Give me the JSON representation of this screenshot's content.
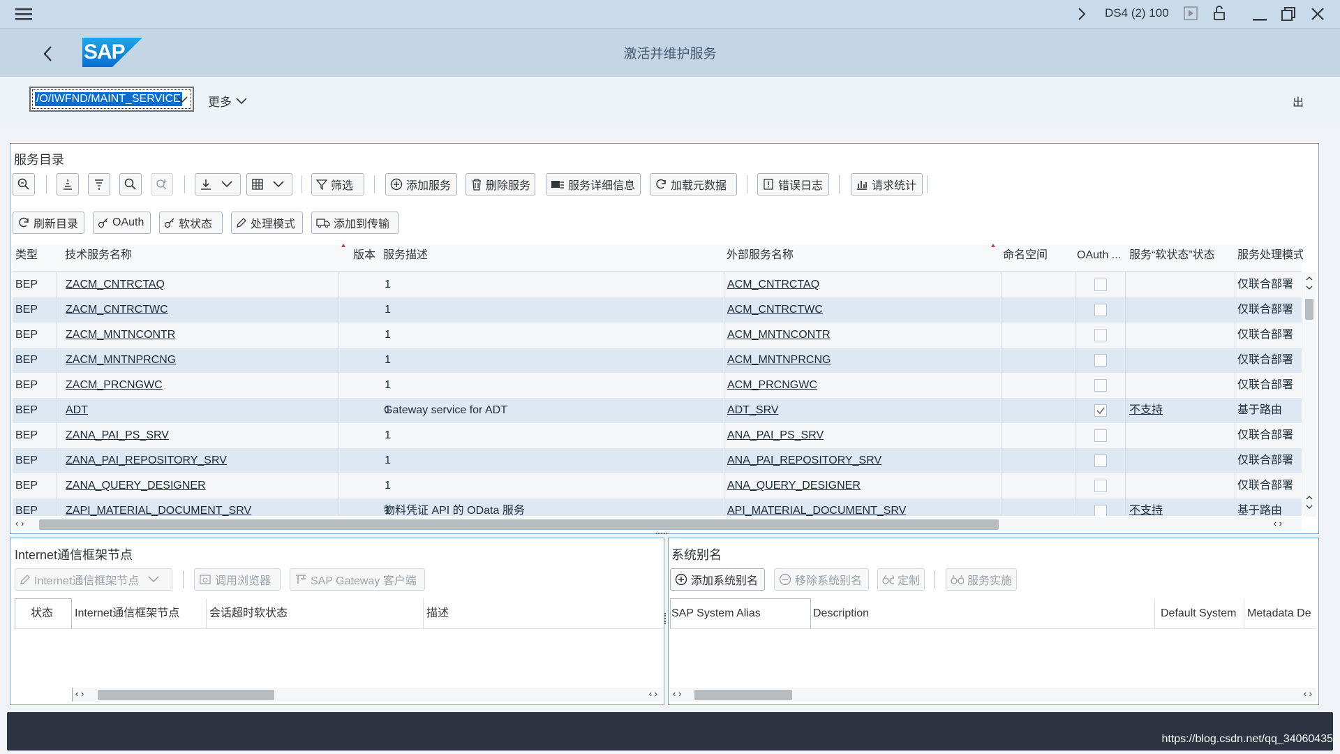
{
  "titlebar": {
    "system": "DS4 (2) 100"
  },
  "header": {
    "title": "激活并维护服务",
    "logo": "SAP"
  },
  "toolbar": {
    "tcode": "/O/IWFND/MAINT_SERVICE",
    "more": "更多",
    "exit": "出"
  },
  "catalog": {
    "title": "服务目录",
    "buttons": {
      "filter": "筛选",
      "add_service": "添加服务",
      "delete_service": "删除服务",
      "service_details": "服务详细信息",
      "load_metadata": "加载元数据",
      "error_log": "错误日志",
      "request_stats": "请求统计",
      "refresh_catalog": "刷新目录",
      "oauth": "OAuth",
      "soft_state": "软状态",
      "processing_mode": "处理模式",
      "add_to_transport": "添加到传输"
    },
    "columns": [
      "类型",
      "技术服务名称",
      "版本",
      "服务描述",
      "外部服务名称",
      "命名空间",
      "OAuth ...",
      "服务“软状态”状态",
      "服务处理模式"
    ],
    "rows": [
      {
        "type": "BEP",
        "tech": "ZACM_CNTRCTAQ",
        "ver": "1",
        "desc": "",
        "ext": "ACM_CNTRCTAQ",
        "ns": "",
        "oauth": false,
        "soft": "",
        "mode": "仅联合部署"
      },
      {
        "type": "BEP",
        "tech": "ZACM_CNTRCTWC",
        "ver": "1",
        "desc": "",
        "ext": "ACM_CNTRCTWC",
        "ns": "",
        "oauth": false,
        "soft": "",
        "mode": "仅联合部署"
      },
      {
        "type": "BEP",
        "tech": "ZACM_MNTNCONTR",
        "ver": "1",
        "desc": "",
        "ext": "ACM_MNTNCONTR",
        "ns": "",
        "oauth": false,
        "soft": "",
        "mode": "仅联合部署"
      },
      {
        "type": "BEP",
        "tech": "ZACM_MNTNPRCNG",
        "ver": "1",
        "desc": "",
        "ext": "ACM_MNTNPRCNG",
        "ns": "",
        "oauth": false,
        "soft": "",
        "mode": "仅联合部署"
      },
      {
        "type": "BEP",
        "tech": "ZACM_PRCNGWC",
        "ver": "1",
        "desc": "",
        "ext": "ACM_PRCNGWC",
        "ns": "",
        "oauth": false,
        "soft": "",
        "mode": "仅联合部署"
      },
      {
        "type": "BEP",
        "tech": "ADT",
        "ver": "1",
        "desc": "Gateway service for ADT",
        "ext": "ADT_SRV",
        "ns": "",
        "oauth": true,
        "soft": "不支持",
        "mode": "基于路由"
      },
      {
        "type": "BEP",
        "tech": "ZANA_PAI_PS_SRV",
        "ver": "1",
        "desc": "",
        "ext": "ANA_PAI_PS_SRV",
        "ns": "",
        "oauth": false,
        "soft": "",
        "mode": "仅联合部署"
      },
      {
        "type": "BEP",
        "tech": "ZANA_PAI_REPOSITORY_SRV",
        "ver": "1",
        "desc": "",
        "ext": "ANA_PAI_REPOSITORY_SRV",
        "ns": "",
        "oauth": false,
        "soft": "",
        "mode": "仅联合部署"
      },
      {
        "type": "BEP",
        "tech": "ZANA_QUERY_DESIGNER",
        "ver": "1",
        "desc": "",
        "ext": "ANA_QUERY_DESIGNER",
        "ns": "",
        "oauth": false,
        "soft": "",
        "mode": "仅联合部署"
      },
      {
        "type": "BEP",
        "tech": "ZAPI_MATERIAL_DOCUMENT_SRV",
        "ver": "1",
        "desc": "物料凭证 API 的 OData 服务",
        "ext": "API_MATERIAL_DOCUMENT_SRV",
        "ns": "",
        "oauth": false,
        "soft": "不支持",
        "mode": "基于路由"
      }
    ]
  },
  "icf": {
    "title": "Internet通信框架节点",
    "buttons": {
      "icf_node": "Internet通信框架节点",
      "call_browser": "调用浏览器",
      "gateway_client": "SAP Gateway 客户端"
    },
    "columns": [
      "状态",
      "Internet通信框架节点",
      "会话超时软状态",
      "描述"
    ]
  },
  "alias": {
    "title": "系统别名",
    "buttons": {
      "add_alias": "添加系统别名",
      "remove_alias": "移除系统别名",
      "customize": "定制",
      "service_impl": "服务实施"
    },
    "columns": [
      "SAP System Alias",
      "Description",
      "Default System",
      "Metadata De"
    ]
  },
  "footer": {
    "watermark": "https://blog.csdn.net/qq_34060435"
  }
}
